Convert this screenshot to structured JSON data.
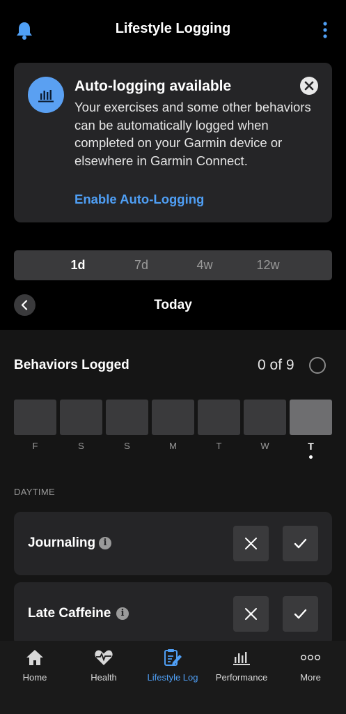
{
  "header": {
    "title": "Lifestyle Logging",
    "bell_icon": "bell-icon",
    "menu_icon": "kebab-menu-icon"
  },
  "banner": {
    "title": "Auto-logging available",
    "body": "Your exercises and some other behaviors can be automatically logged when completed on your Garmin device or elsewhere in Garmin Connect.",
    "link": "Enable Auto-Logging",
    "icon": "bar-chart-icon",
    "accent": "#5aa0f2"
  },
  "range": {
    "options": [
      "1d",
      "7d",
      "4w",
      "12w"
    ],
    "selected": "1d"
  },
  "date_nav": {
    "label": "Today"
  },
  "behaviors": {
    "title": "Behaviors Logged",
    "count": "0 of 9",
    "days": [
      "F",
      "S",
      "S",
      "M",
      "T",
      "W",
      "T"
    ],
    "today_index": 6,
    "section": "DAYTIME",
    "items": [
      {
        "name": "Journaling"
      },
      {
        "name": "Late Caffeine"
      }
    ]
  },
  "tabs": [
    {
      "label": "Home",
      "icon": "home-icon"
    },
    {
      "label": "Health",
      "icon": "heart-pulse-icon"
    },
    {
      "label": "Lifestyle Log",
      "icon": "clipboard-edit-icon",
      "active": true
    },
    {
      "label": "Performance",
      "icon": "bar-chart-icon"
    },
    {
      "label": "More",
      "icon": "more-dots-icon"
    }
  ],
  "colors": {
    "link": "#4f9ff5",
    "card": "#252527",
    "background": "#000000"
  }
}
